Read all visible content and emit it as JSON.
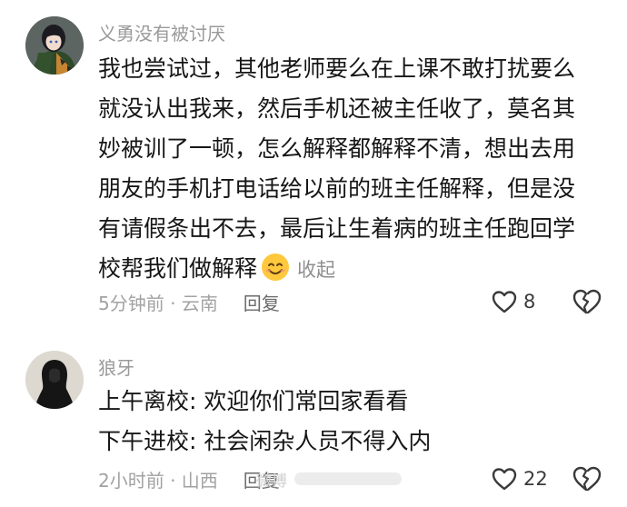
{
  "comments": [
    {
      "username": "义勇没有被讨厌",
      "lines": [
        "我也尝试过，其他老师要么在上课不敢打扰要么",
        "就没认出我来，然后手机还被主任收了，莫名其",
        "妙被训了一顿，怎么解释都解释不清，想出去用",
        "朋友的手机打电话给以前的班主任解释，但是没",
        "有请假条出不去，最后让生着病的班主任跑回学",
        "校帮我们做解释"
      ],
      "collapse_label": "收起",
      "time_location": "5分钟前 · 云南",
      "reply_label": "回复",
      "like_count": "8"
    },
    {
      "username": "狼牙",
      "lines": [
        "上午离校: 欢迎你们常回家看看",
        "下午进校: 社会闲杂人员不得入内"
      ],
      "time_location": "2小时前 · 山西",
      "reply_label": "回复",
      "like_count": "22"
    }
  ],
  "watermark": {
    "text": "微博"
  },
  "colors": {
    "username": "#9a9a9a",
    "body_text": "#161616",
    "meta_text": "#a2a2a2",
    "icon_stroke": "#3a3a3a",
    "emoji_fill": "#ffc83d"
  },
  "icons": {
    "like": "heart-outline-icon",
    "dislike": "broken-heart-icon",
    "emoji": "smiling-face-emoji"
  }
}
